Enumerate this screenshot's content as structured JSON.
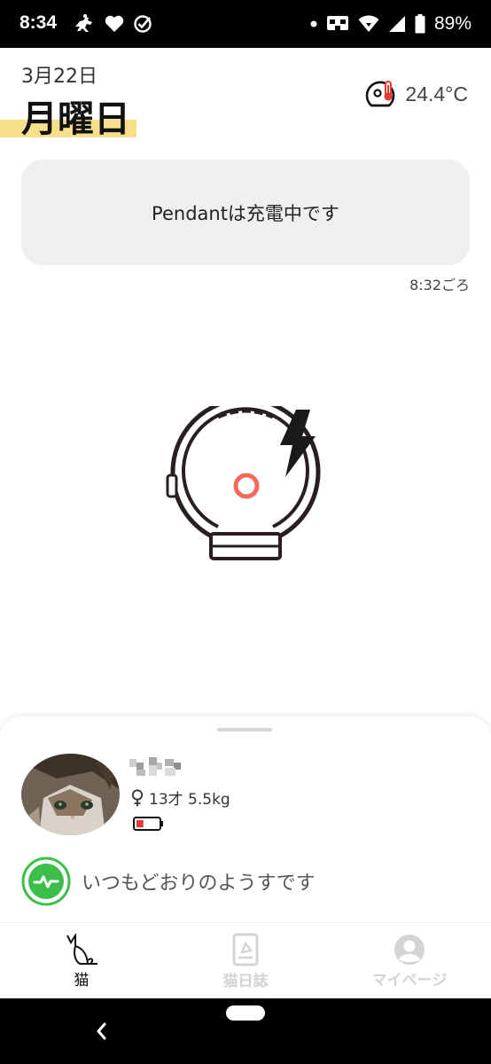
{
  "status_bar": {
    "time": "8:34",
    "battery": "89%"
  },
  "header": {
    "date": "3月22日",
    "day": "月曜日",
    "temperature": "24.4°C",
    "highlight_color": "#f7e08a"
  },
  "message": {
    "text": "Pendantは充電中です",
    "time": "8:32ごろ"
  },
  "device": {
    "icons": [
      "pendant-icon",
      "lightning-icon"
    ],
    "indicator_color": "#f26b5b"
  },
  "pet": {
    "name_blurred": true,
    "info": "13才 5.5kg",
    "gender_icon": "female-icon",
    "battery_level": 0.3,
    "battery_color": "#e53935",
    "status": "いつもどおりのようすです",
    "status_color": "#3cbf4a"
  },
  "nav": {
    "items": [
      {
        "label": "猫",
        "icon": "cat-icon",
        "active": true
      },
      {
        "label": "猫日誌",
        "icon": "diary-icon",
        "active": false
      },
      {
        "label": "マイページ",
        "icon": "profile-icon",
        "active": false
      }
    ]
  }
}
